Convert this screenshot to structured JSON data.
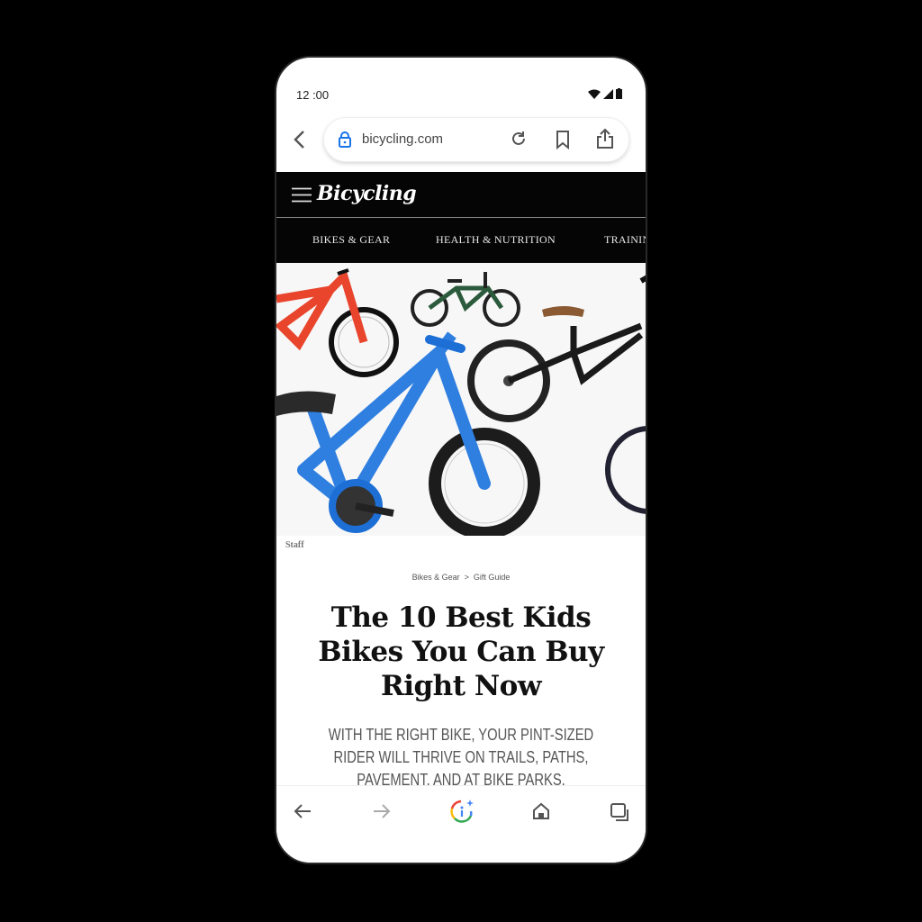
{
  "status": {
    "time": "12 :00"
  },
  "browser": {
    "url": "bicycling.com"
  },
  "site": {
    "logo": "Bicycling",
    "nav": [
      "BIKES & GEAR",
      "HEALTH & NUTRITION",
      "TRAINING"
    ]
  },
  "article": {
    "photo_credit": "Staff",
    "breadcrumb": {
      "parent": "Bikes & Gear",
      "separator": ">",
      "current": "Gift Guide"
    },
    "title": "The 10 Best Kids Bikes You Can Buy Right Now",
    "dek": "WITH THE RIGHT BIKE, YOUR PINT-SIZED RIDER WILL THRIVE ON TRAILS, PATHS, PAVEMENT, AND AT BIKE PARKS."
  },
  "colors": {
    "accent_blue": "#1a73e8",
    "header_bg": "#050505"
  }
}
